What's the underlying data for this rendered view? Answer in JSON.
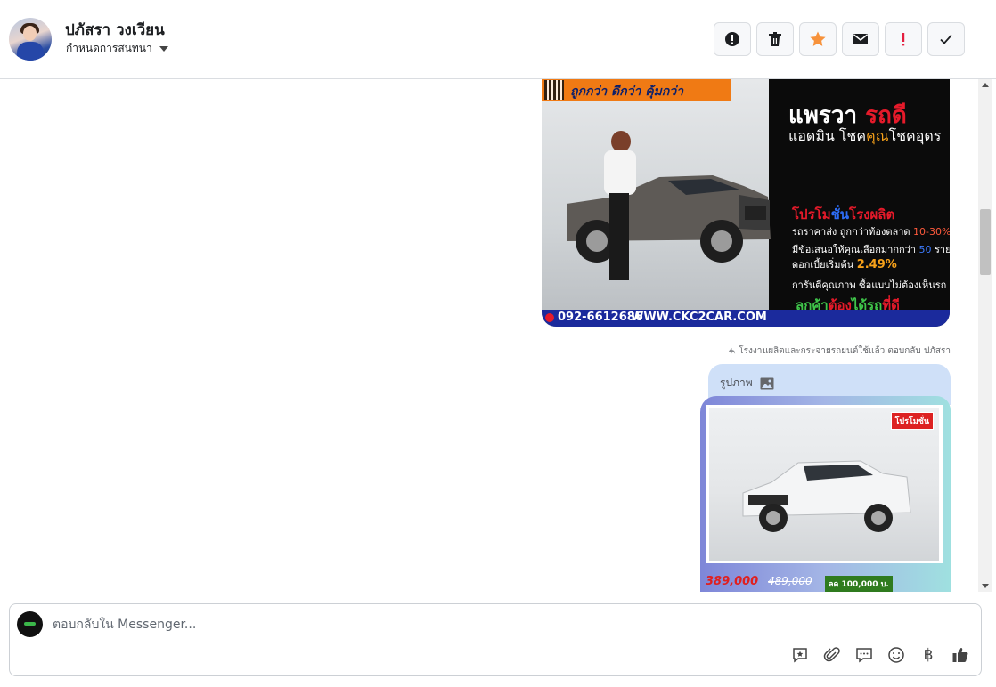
{
  "header": {
    "user_name": "ปภัสรา วงเวียน",
    "assign_label": "กำหนดการสนทนา",
    "toolbar": [
      {
        "name": "spam-button",
        "icon": "alert-circle-icon"
      },
      {
        "name": "delete-button",
        "icon": "trash-icon"
      },
      {
        "name": "star-button",
        "icon": "star-icon",
        "color": "#f7923b"
      },
      {
        "name": "mark-unread-button",
        "icon": "envelope-icon"
      },
      {
        "name": "follow-up-button",
        "icon": "exclamation-icon",
        "color": "#e41e3f"
      },
      {
        "name": "mark-done-button",
        "icon": "check-icon"
      }
    ]
  },
  "messages": {
    "ad1": {
      "banner": "ถูกกว่า ดีกว่า คุ้มกว่า",
      "title_a": "แพรวา",
      "title_b": "รถดี",
      "subtitle_a": "แอดมิน โชค",
      "subtitle_b": "คุณ",
      "subtitle_c": "โชคอุดร",
      "promo_a": "โปรโม",
      "promo_b": "ชั่น",
      "promo_c": "โรงผลิต",
      "line1_a": "รถราคาส่ง ถูกกว่าท้องตลาด ",
      "line1_b": "10-30%",
      "line2_a": "มีข้อเสนอให้คุณเลือกมากกว่า ",
      "line2_b": "50",
      "line2_c": " รายการ",
      "line3_a": "ดอกเบี้ยเริ่มต้น ",
      "line3_b": "2.49%",
      "line4": "การันตีคุณภาพ ซื้อแบบไม่ต้องเห็นรถ",
      "tagline_a": "ลูกค้า",
      "tagline_b": "ต้อง",
      "tagline_c": "ได้รถ",
      "tagline_d": "ที่ดี",
      "phone": "092-6612686",
      "website": "WWW.CKC2CAR.COM"
    },
    "reply_note": "โรงงานผลิตและกระจายรถยนต์ใช้แล้ว ตอบกลับ ปภัสรา",
    "photo_label": "รูปภาพ",
    "ad2": {
      "promo_tag": "โปรโมชั่น",
      "price_now": "389,000",
      "price_old": "489,000",
      "discount": "ลด 100,000 บ."
    }
  },
  "composer": {
    "placeholder": "ตอบกลับใน Messenger...",
    "tools": [
      "saved-reply-icon",
      "attachment-icon",
      "chat-bubble-icon",
      "emoji-icon",
      "baht-icon",
      "thumbs-up-icon"
    ],
    "baht_symbol": "฿"
  }
}
